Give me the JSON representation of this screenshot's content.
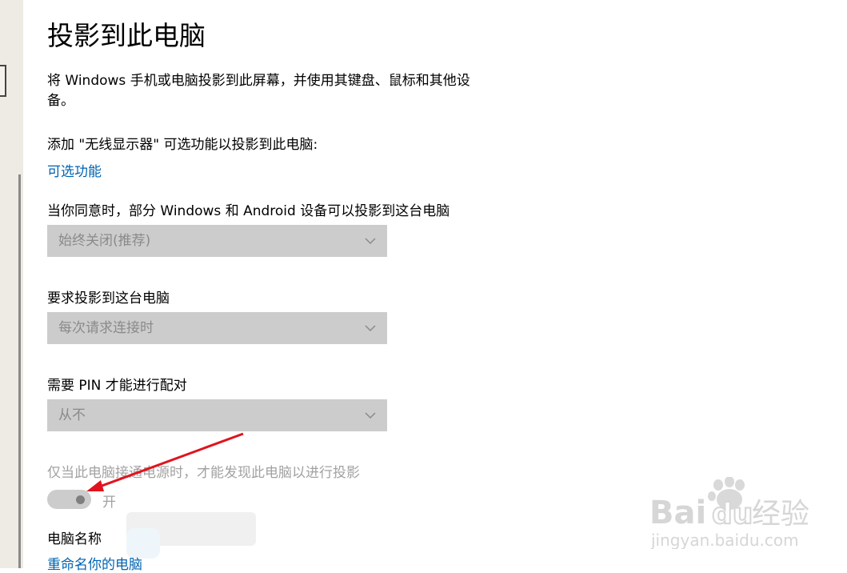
{
  "page": {
    "title": "投影到此电脑",
    "description": "将 Windows 手机或电脑投影到此屏幕，并使用其键盘、鼠标和其他设备。"
  },
  "optional_features": {
    "label": "添加 \"无线显示器\" 可选功能以投影到此电脑:",
    "link": "可选功能"
  },
  "settings": {
    "availability": {
      "label": "当你同意时，部分 Windows 和 Android 设备可以投影到这台电脑",
      "value": "始终关闭(推荐)"
    },
    "ask_to_project": {
      "label": "要求投影到这台电脑",
      "value": "每次请求连接时"
    },
    "require_pin": {
      "label": "需要 PIN 才能进行配对",
      "value": "从不"
    },
    "power_only": {
      "label": "仅当此电脑接通电源时，才能发现此电脑以进行投影",
      "toggle_state": "开",
      "enabled": false
    }
  },
  "pc_name": {
    "label": "电脑名称",
    "link": "重命名你的电脑"
  },
  "watermark": {
    "brand": "Baidu 经验",
    "url": "jingyan.baidu.com"
  },
  "colors": {
    "link": "#0063b1",
    "dropdown_bg": "#cccccc",
    "annotation_arrow": "#e0141e"
  },
  "icons": {
    "dropdown": "chevron-down-icon",
    "annotation": "red-arrow-annotation"
  }
}
